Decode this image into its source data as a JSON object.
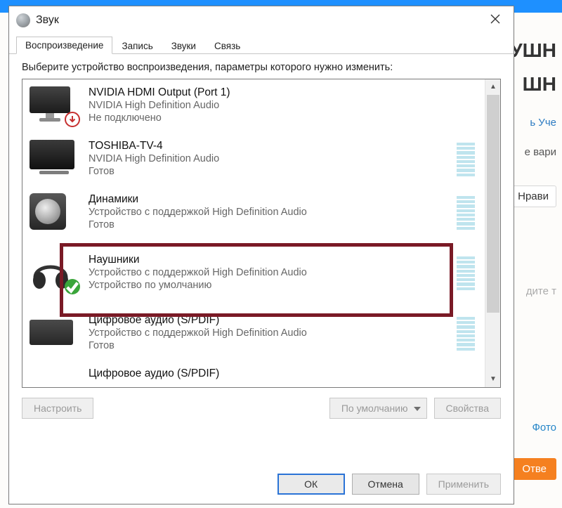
{
  "background": {
    "heading_frag_1": "УШН",
    "heading_frag_2": "ШН",
    "rep_frag": "ь Уче",
    "choose_variant_frag": "е вари",
    "like_btn_frag": "Нрави",
    "placeholder_frag": "дите т",
    "photo_link": "Фото",
    "answer_btn": "Отве"
  },
  "dialog": {
    "title": "Звук",
    "tabs": [
      "Воспроизведение",
      "Запись",
      "Звуки",
      "Связь"
    ],
    "active_tab_index": 0,
    "instructions": "Выберите устройство воспроизведения, параметры которого нужно изменить:",
    "devices": [
      {
        "icon": "monitor-unplugged",
        "title": "NVIDIA HDMI Output (Port 1)",
        "line1": "NVIDIA High Definition Audio",
        "line2": "Не подключено",
        "meter": false
      },
      {
        "icon": "tv",
        "title": "TOSHIBA-TV-4",
        "line1": "NVIDIA High Definition Audio",
        "line2": "Готов",
        "meter": true
      },
      {
        "icon": "speaker",
        "title": "Динамики",
        "line1": "Устройство с поддержкой High Definition Audio",
        "line2": "Готов",
        "meter": true
      },
      {
        "icon": "headphones-default",
        "title": "Наушники",
        "line1": "Устройство с поддержкой High Definition Audio",
        "line2": "Устройство по умолчанию",
        "meter": true
      },
      {
        "icon": "receiver",
        "title": "Цифровое аудио (S/PDIF)",
        "line1": "Устройство с поддержкой High Definition Audio",
        "line2": "Готов",
        "meter": true
      },
      {
        "icon": "receiver",
        "title": "Цифровое аудио (S/PDIF)",
        "line1": "",
        "line2": "",
        "meter": false
      }
    ],
    "buttons": {
      "configure": "Настроить",
      "set_default": "По умолчанию",
      "properties": "Свойства",
      "ok": "ОК",
      "cancel": "Отмена",
      "apply": "Применить"
    }
  }
}
